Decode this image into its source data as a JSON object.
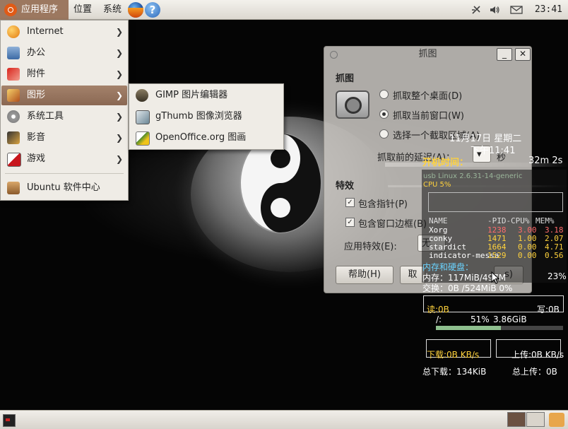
{
  "top_panel": {
    "menus": [
      "应用程序",
      "位置",
      "系统"
    ],
    "clock": "23:41",
    "tray_icons": [
      "network-disabled-icon",
      "volume-icon",
      "mail-icon"
    ]
  },
  "app_menu": {
    "items": [
      {
        "label": "Internet",
        "icon": "globe-icon",
        "has_submenu": true
      },
      {
        "label": "办公",
        "icon": "office-icon",
        "has_submenu": true
      },
      {
        "label": "附件",
        "icon": "accessories-icon",
        "has_submenu": true
      },
      {
        "label": "图形",
        "icon": "graphics-icon",
        "has_submenu": true,
        "highlighted": true
      },
      {
        "label": "系统工具",
        "icon": "system-tools-icon",
        "has_submenu": true
      },
      {
        "label": "影音",
        "icon": "multimedia-icon",
        "has_submenu": true
      },
      {
        "label": "游戏",
        "icon": "games-icon",
        "has_submenu": true
      },
      {
        "label": "Ubuntu 软件中心",
        "icon": "software-center-icon",
        "has_submenu": false
      }
    ]
  },
  "graphics_submenu": {
    "items": [
      {
        "label": "GIMP 图片编辑器",
        "icon": "gimp-icon"
      },
      {
        "label": "gThumb 图像浏览器",
        "icon": "gthumb-icon"
      },
      {
        "label": "OpenOffice.org 图画",
        "icon": "draw-icon"
      }
    ]
  },
  "screenshot_dialog": {
    "title": "抓图",
    "section_title": "抓图",
    "options": [
      "抓取整个桌面(D)",
      "抓取当前窗口(W)",
      "选择一个截取区域(A)"
    ],
    "selected_option": 1,
    "delay_label": "抓取前的延迟(A)：",
    "delay_unit": "秒",
    "effects_title": "特效",
    "include_pointer": "包含指针(P)",
    "include_border": "包含窗口边框(B)",
    "app_effect_label": "应用特效(E):",
    "app_effect_value": "无",
    "help_button": "帮助(H)",
    "cancel_button": "取",
    "grab_button": "s)"
  },
  "conky": {
    "date": "11月17日 星期二",
    "time": "下午11:41",
    "uptime_label": "开机时间：",
    "uptime_value": "32m 2s",
    "kernel": "usb  Linux 2.6.31-14-generic",
    "cpu": "CPU   5%",
    "proc_headers": [
      "NAME",
      "-PID-",
      "CPU%",
      "MEM%"
    ],
    "processes": [
      {
        "name": "Xorg",
        "pid": "1238",
        "cpu": "3.00",
        "mem": "3.18"
      },
      {
        "name": "conky",
        "pid": "1471",
        "cpu": "1.00",
        "mem": "2.07"
      },
      {
        "name": "stardict",
        "pid": "1664",
        "cpu": "0.00",
        "mem": "4.71"
      },
      {
        "name": "indicator-messa",
        "pid": "1529",
        "cpu": "0.00",
        "mem": "0.56"
      }
    ],
    "mem_disk_title": "内存和硬盘：",
    "memory": "内存：117MiB/497M",
    "memory_percent": "23%",
    "swap": "交换：0B   /524MiB  0%",
    "read": "读:0B",
    "write": "写:0B",
    "disk_root": "/:",
    "disk_percent": "51%",
    "disk_free": "3.86GiB",
    "disk_fill": 0.51,
    "download_rate": "下载:0B   KB/s",
    "upload_rate": "上传:0B   KB/s",
    "total_download": "总下载：134KiB",
    "total_upload": "总上传：0B"
  },
  "colors": {
    "menu_highlight": "#9c7860",
    "panel": "#e6e3dc",
    "conky_yellow": "#ffd23c",
    "conky_cyan": "#6ad3ff"
  }
}
